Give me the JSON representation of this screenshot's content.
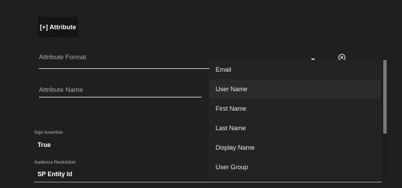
{
  "add_attribute_button": "[+] Attribute",
  "attribute_format": {
    "placeholder": "Attribute Format"
  },
  "attribute_name": {
    "placeholder": "Attribute Name"
  },
  "icons": {
    "dropdown": "caret-down-icon",
    "remove": "close-circle-icon"
  },
  "sign_assertion": {
    "label": "Sign Assertion",
    "value": "True"
  },
  "audience_restriction": {
    "label": "Audience Restriction",
    "value": "SP Entity Id"
  },
  "dropdown": {
    "items": [
      {
        "label": "Email"
      },
      {
        "label": "User Name",
        "selected": true
      },
      {
        "label": "First Name"
      },
      {
        "label": "Last Name"
      },
      {
        "label": "Display Name"
      },
      {
        "label": "User Group"
      }
    ]
  }
}
